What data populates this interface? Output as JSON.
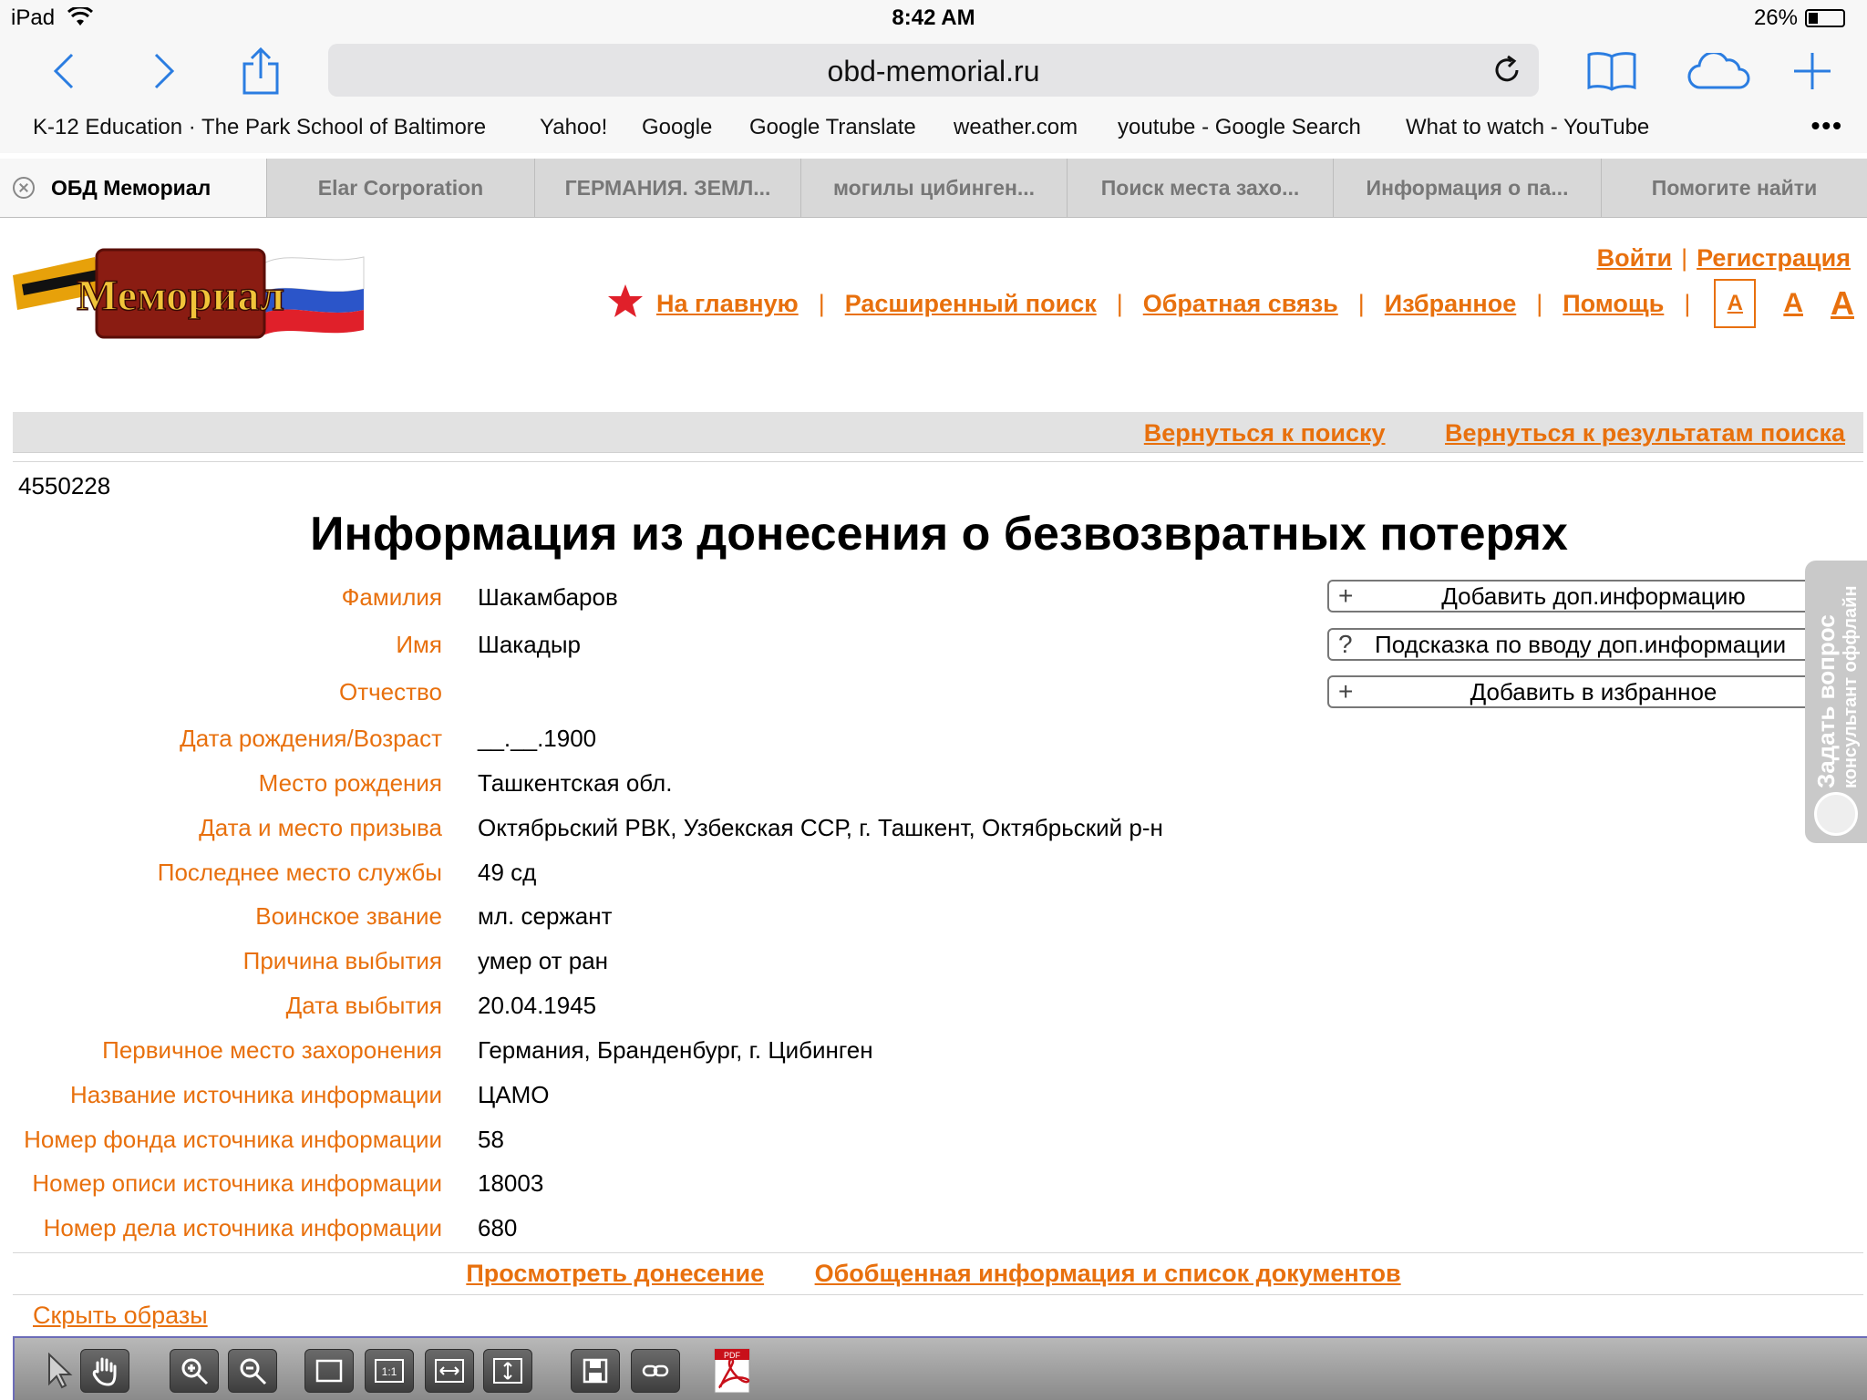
{
  "status": {
    "device": "iPad",
    "time": "8:42 AM",
    "battery": "26%"
  },
  "browser": {
    "url": "obd-memorial.ru",
    "bookmarks": [
      "K-12 Education · The Park School of Baltimore",
      "Yahoo!",
      "Google",
      "Google Translate",
      "weather.com",
      "youtube - Google Search",
      "What to watch - YouTube"
    ],
    "tabs": [
      "ОБД Мемориал",
      "Elar Corporation",
      "ГЕРМАНИЯ. ЗЕМЛ...",
      "могилы цибинген...",
      "Поиск места захо...",
      "Информация о па...",
      "Помогите найти"
    ]
  },
  "site": {
    "logo_text": "Мемориал",
    "login": "Войти",
    "register": "Регистрация",
    "nav": [
      "На главную",
      "Расширенный поиск",
      "Обратная связь",
      "Избранное",
      "Помощь"
    ],
    "font_size_labels": [
      "A",
      "A",
      "A"
    ],
    "back_to_search": "Вернуться к поиску",
    "back_to_results": "Вернуться к результатам поиска"
  },
  "record": {
    "id": "4550228",
    "title": "Информация из донесения о безвозвратных потерях",
    "fields": [
      {
        "label": "Фамилия",
        "value": "Шакамбаров"
      },
      {
        "label": "Имя",
        "value": "Шакадыр"
      },
      {
        "label": "Отчество",
        "value": ""
      },
      {
        "label": "Дата рождения/Возраст",
        "value": "__.__.1900"
      },
      {
        "label": "Место рождения",
        "value": "Ташкентская обл."
      },
      {
        "label": "Дата и место призыва",
        "value": "Октябрьский РВК, Узбекская ССР, г. Ташкент, Октябрьский р-н"
      },
      {
        "label": "Последнее место службы",
        "value": "49 сд"
      },
      {
        "label": "Воинское звание",
        "value": "мл. сержант"
      },
      {
        "label": "Причина выбытия",
        "value": "умер от ран"
      },
      {
        "label": "Дата выбытия",
        "value": "20.04.1945"
      },
      {
        "label": "Первичное место захоронения",
        "value": "Германия, Бранденбург, г. Цибинген"
      },
      {
        "label": "Название источника информации",
        "value": "ЦАМО"
      },
      {
        "label": "Номер фонда источника информации",
        "value": "58"
      },
      {
        "label": "Номер описи источника информации",
        "value": "18003"
      },
      {
        "label": "Номер дела источника информации",
        "value": "680"
      }
    ]
  },
  "actions": {
    "add_info": "Добавить доп.информацию",
    "hint": "Подсказка по вводу доп.информации",
    "add_favorite": "Добавить в избранное",
    "ask_question": "Задать вопрос",
    "consultant": "консультант оффлайн"
  },
  "bottom": {
    "view_report": "Просмотреть донесение",
    "summary": "Обобщенная информация и список документов",
    "hide_images": "Скрыть образы"
  },
  "colors": {
    "accent": "#e8700d",
    "ios_blue": "#2b7de1"
  }
}
